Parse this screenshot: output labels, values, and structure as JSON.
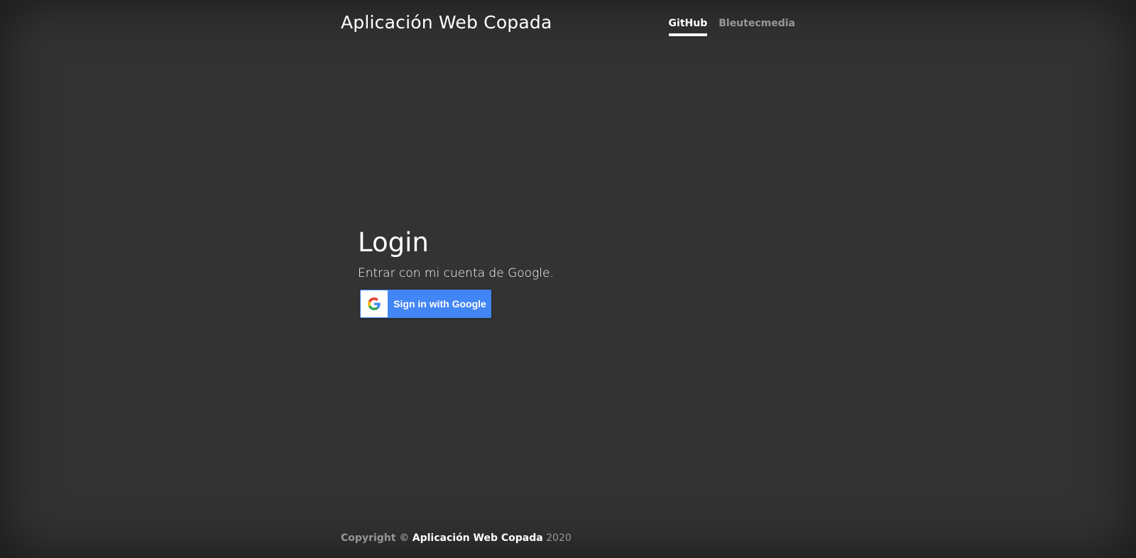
{
  "header": {
    "brand": "Aplicación Web Copada",
    "nav": [
      {
        "label": "GitHub",
        "active": true
      },
      {
        "label": "Bleutecmedia",
        "active": false
      }
    ]
  },
  "main": {
    "title": "Login",
    "lead": "Entrar con mi cuenta de Google.",
    "google_button": {
      "label": "Sign in with Google",
      "icon": "google-g-icon",
      "color": "#4285f4"
    }
  },
  "footer": {
    "copyright": "Copyright ©",
    "app_name": "Aplicación Web Copada",
    "year": "2020"
  },
  "colors": {
    "background": "#333333",
    "text": "#ffffff",
    "muted": "#999999"
  }
}
